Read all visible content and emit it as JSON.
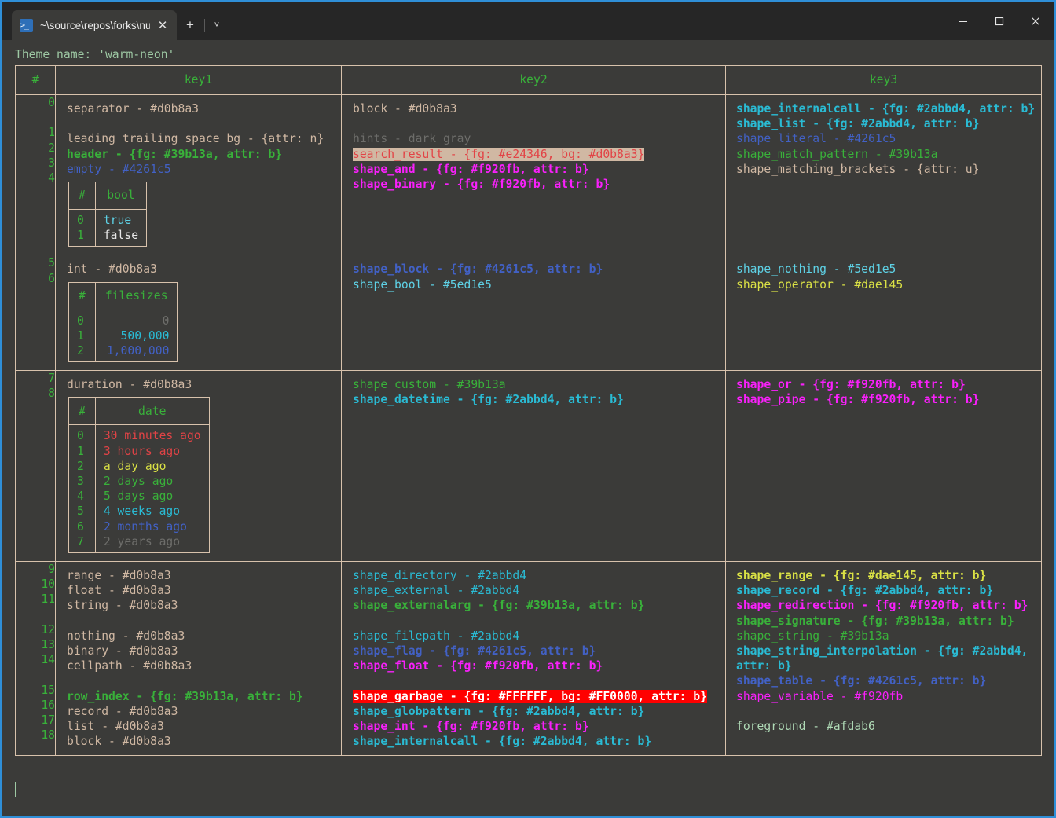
{
  "window": {
    "tab": {
      "title": "~\\source\\repos\\forks\\nu_scrip",
      "icon": "powershell-icon",
      "close_label": "✕"
    },
    "new_tab_label": "+",
    "dropdown_label": "˅",
    "controls": {
      "minimize": "minimize-icon",
      "maximize": "maximize-icon",
      "close": "close-icon"
    },
    "accent_border": "#2f8fd8"
  },
  "terminal": {
    "theme_line": "Theme name: 'warm-neon'",
    "background": "#3b3b39",
    "foreground": "#afdab6",
    "border_color": "#d8c2ac"
  },
  "table": {
    "headers": [
      "#",
      "key1",
      "key2",
      "key3"
    ],
    "groups": [
      {
        "indices": [
          "0",
          "",
          "1",
          "2",
          "3",
          "4"
        ],
        "key1": [
          {
            "t": "separator - #d0b8a3",
            "c": "c-tan"
          },
          {
            "t": "",
            "c": "blank"
          },
          {
            "t": "leading_trailing_space_bg - {attr: n}",
            "c": "c-tan"
          },
          {
            "t": "header - {fg: #39b13a, attr: b}",
            "c": "c-green"
          },
          {
            "t": "empty - #4261c5",
            "c": "c-blue"
          },
          {
            "nested": "bool"
          }
        ],
        "key2": [
          {
            "t": "block - #d0b8a3",
            "c": "c-tan"
          },
          {
            "t": "",
            "c": "blank"
          },
          {
            "t": "hints - dark_gray",
            "c": "c-gray"
          },
          {
            "t": "search_result - {fg: #e24346, bg: #d0b8a3}",
            "c": "hl-search"
          },
          {
            "t": "shape_and - {fg: #f920fb, attr: b}",
            "c": "c-magb"
          },
          {
            "t": "shape_binary - {fg: #f920fb, attr: b}",
            "c": "c-magb"
          }
        ],
        "key3": [
          {
            "t": "shape_internalcall - {fg: #2abbd4, attr: b}",
            "c": "c-cyanb"
          },
          {
            "t": "shape_list - {fg: #2abbd4, attr: b}",
            "c": "c-cyanb"
          },
          {
            "t": "shape_literal - #4261c5",
            "c": "c-blue"
          },
          {
            "t": "shape_match_pattern - #39b13a",
            "c": "c-greenp"
          },
          {
            "t": "shape_matching_brackets - {attr: u}",
            "c": "c-under"
          }
        ]
      },
      {
        "indices": [
          "5",
          "6"
        ],
        "key1": [
          {
            "t": "int - #d0b8a3",
            "c": "c-tan"
          },
          {
            "nested": "filesizes"
          }
        ],
        "key2": [
          {
            "t": "shape_block - {fg: #4261c5, attr: b}",
            "c": "c-blueb"
          },
          {
            "t": "shape_bool - #5ed1e5",
            "c": "c-teal"
          }
        ],
        "key3": [
          {
            "t": "shape_nothing - #5ed1e5",
            "c": "c-teal"
          },
          {
            "t": "shape_operator - #dae145",
            "c": "c-yellow"
          }
        ]
      },
      {
        "indices": [
          "7",
          "8"
        ],
        "key1": [
          {
            "t": "duration - #d0b8a3",
            "c": "c-tan"
          },
          {
            "nested": "date"
          }
        ],
        "key2": [
          {
            "t": "shape_custom - #39b13a",
            "c": "c-greenp"
          },
          {
            "t": "shape_datetime - {fg: #2abbd4, attr: b}",
            "c": "c-cyanb"
          }
        ],
        "key3": [
          {
            "t": "shape_or - {fg: #f920fb, attr: b}",
            "c": "c-magb"
          },
          {
            "t": "shape_pipe - {fg: #f920fb, attr: b}",
            "c": "c-magb"
          }
        ]
      },
      {
        "indices": [
          "9",
          "10",
          "11",
          "",
          "12",
          "13",
          "14",
          "",
          "15",
          "16",
          "17",
          "18"
        ],
        "key1": [
          {
            "t": "range - #d0b8a3",
            "c": "c-tan"
          },
          {
            "t": "float - #d0b8a3",
            "c": "c-tan"
          },
          {
            "t": "string - #d0b8a3",
            "c": "c-tan"
          },
          {
            "t": "",
            "c": "blank"
          },
          {
            "t": "nothing - #d0b8a3",
            "c": "c-tan"
          },
          {
            "t": "binary - #d0b8a3",
            "c": "c-tan"
          },
          {
            "t": "cellpath - #d0b8a3",
            "c": "c-tan"
          },
          {
            "t": "",
            "c": "blank"
          },
          {
            "t": "row_index - {fg: #39b13a, attr: b}",
            "c": "c-green"
          },
          {
            "t": "record - #d0b8a3",
            "c": "c-tan"
          },
          {
            "t": "list - #d0b8a3",
            "c": "c-tan"
          },
          {
            "t": "block - #d0b8a3",
            "c": "c-tan"
          }
        ],
        "key2": [
          {
            "t": "shape_directory - #2abbd4",
            "c": "c-cyan"
          },
          {
            "t": "shape_external - #2abbd4",
            "c": "c-cyan"
          },
          {
            "t": "shape_externalarg - {fg: #39b13a, attr: b}",
            "c": "c-green"
          },
          {
            "t": "",
            "c": "blank"
          },
          {
            "t": "shape_filepath - #2abbd4",
            "c": "c-cyan"
          },
          {
            "t": "shape_flag - {fg: #4261c5, attr: b}",
            "c": "c-blueb"
          },
          {
            "t": "shape_float - {fg: #f920fb, attr: b}",
            "c": "c-magb"
          },
          {
            "t": "",
            "c": "blank"
          },
          {
            "t": "shape_garbage - {fg: #FFFFFF, bg: #FF0000, attr: b}",
            "c": "hl-garb"
          },
          {
            "t": "shape_globpattern - {fg: #2abbd4, attr: b}",
            "c": "c-cyanb"
          },
          {
            "t": "shape_int - {fg: #f920fb, attr: b}",
            "c": "c-magb"
          },
          {
            "t": "shape_internalcall - {fg: #2abbd4, attr: b}",
            "c": "c-cyanb"
          }
        ],
        "key3": [
          {
            "t": "shape_range - {fg: #dae145, attr: b}",
            "c": "c-yellowb"
          },
          {
            "t": "shape_record - {fg: #2abbd4, attr: b}",
            "c": "c-cyanb"
          },
          {
            "t": "shape_redirection - {fg: #f920fb, attr: b}",
            "c": "c-magb"
          },
          {
            "t": "shape_signature - {fg: #39b13a, attr: b}",
            "c": "c-green"
          },
          {
            "t": "shape_string - #39b13a",
            "c": "c-greenp"
          },
          {
            "t": "shape_string_interpolation - {fg: #2abbd4, attr: b}",
            "c": "c-cyanb"
          },
          {
            "t": "shape_table - {fg: #4261c5, attr: b}",
            "c": "c-blueb"
          },
          {
            "t": "shape_variable - #f920fb",
            "c": "c-mag"
          },
          {
            "t": "",
            "c": "blank"
          },
          {
            "t": "foreground - #afdab6",
            "c": "c-fg"
          }
        ]
      }
    ],
    "nested_tables": {
      "bool": {
        "headers": [
          "#",
          "bool"
        ],
        "rows": [
          {
            "idx": "0",
            "val": "true",
            "c": "c-teal"
          },
          {
            "idx": "1",
            "val": "false",
            "c": "c-white"
          }
        ],
        "align": "left"
      },
      "filesizes": {
        "headers": [
          "#",
          "filesizes"
        ],
        "rows": [
          {
            "idx": "0",
            "val": "0",
            "c": "c-gray"
          },
          {
            "idx": "1",
            "val": "500,000",
            "c": "c-cyan"
          },
          {
            "idx": "2",
            "val": "1,000,000",
            "c": "c-blue"
          }
        ],
        "align": "right"
      },
      "date": {
        "headers": [
          "#",
          "date"
        ],
        "rows": [
          {
            "idx": "0",
            "val": "30 minutes ago",
            "c": "c-red"
          },
          {
            "idx": "1",
            "val": "3 hours ago",
            "c": "c-red"
          },
          {
            "idx": "2",
            "val": "a day ago",
            "c": "c-yellow"
          },
          {
            "idx": "3",
            "val": "2 days ago",
            "c": "c-greenp"
          },
          {
            "idx": "4",
            "val": "5 days ago",
            "c": "c-greenp"
          },
          {
            "idx": "5",
            "val": "4 weeks ago",
            "c": "c-cyan"
          },
          {
            "idx": "6",
            "val": "2 months ago",
            "c": "c-blue"
          },
          {
            "idx": "7",
            "val": "2 years ago",
            "c": "c-gray"
          }
        ],
        "align": "left"
      }
    }
  }
}
